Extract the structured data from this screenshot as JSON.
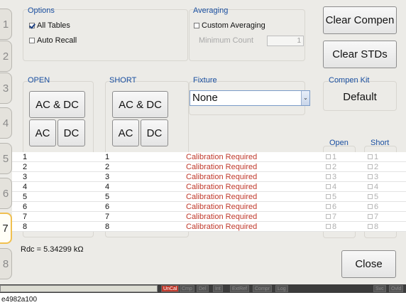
{
  "tabs": [
    "1",
    "2",
    "3",
    "4",
    "5",
    "6",
    "7",
    "8"
  ],
  "active_tab": "7",
  "options": {
    "title": "Options",
    "all_tables": "All Tables",
    "all_tables_checked": true,
    "auto_recall": "Auto Recall",
    "auto_recall_checked": false
  },
  "averaging": {
    "title": "Averaging",
    "custom_averaging": "Custom Averaging",
    "custom_averaging_checked": false,
    "minimum_count_label": "Minimum Count",
    "minimum_count_value": "1"
  },
  "buttons": {
    "clear_compen": "Clear Compen",
    "clear_stds": "Clear STDs",
    "close": "Close"
  },
  "open_group": {
    "title": "OPEN",
    "ac_dc": "AC & DC",
    "ac": "AC",
    "dc": "DC"
  },
  "short_group": {
    "title": "SHORT",
    "ac_dc": "AC & DC",
    "ac": "AC",
    "dc": "DC"
  },
  "fixture": {
    "title": "Fixture",
    "selected": "None"
  },
  "compen_kit": {
    "title": "Compen Kit",
    "value": "Default"
  },
  "table": {
    "open_header": "Open",
    "short_header": "Short",
    "rows": [
      {
        "open": "1",
        "short": "1",
        "status": "Calibration Required",
        "ck_open": "1",
        "ck_short": "1"
      },
      {
        "open": "2",
        "short": "2",
        "status": "Calibration Required",
        "ck_open": "2",
        "ck_short": "2"
      },
      {
        "open": "3",
        "short": "3",
        "status": "Calibration Required",
        "ck_open": "3",
        "ck_short": "3"
      },
      {
        "open": "4",
        "short": "4",
        "status": "Calibration Required",
        "ck_open": "4",
        "ck_short": "4"
      },
      {
        "open": "5",
        "short": "5",
        "status": "Calibration Required",
        "ck_open": "5",
        "ck_short": "5"
      },
      {
        "open": "6",
        "short": "6",
        "status": "Calibration Required",
        "ck_open": "6",
        "ck_short": "6"
      },
      {
        "open": "7",
        "short": "7",
        "status": "Calibration Required",
        "ck_open": "7",
        "ck_short": "7"
      },
      {
        "open": "8",
        "short": "8",
        "status": "Calibration Required",
        "ck_open": "8",
        "ck_short": "8"
      }
    ]
  },
  "rdc": "Rdc = 5.34299 kΩ",
  "statusbar": {
    "items": [
      "UnCal",
      "Cmp",
      "Del",
      "Int",
      "ExtRef",
      "Compr",
      "Log"
    ],
    "right_items": [
      "Svc",
      "Ovld"
    ]
  },
  "caption": "e4982a100",
  "colors": {
    "label_blue": "#1a4fa0",
    "status_red": "#c0392b",
    "active_tab_border": "#f0c050"
  }
}
